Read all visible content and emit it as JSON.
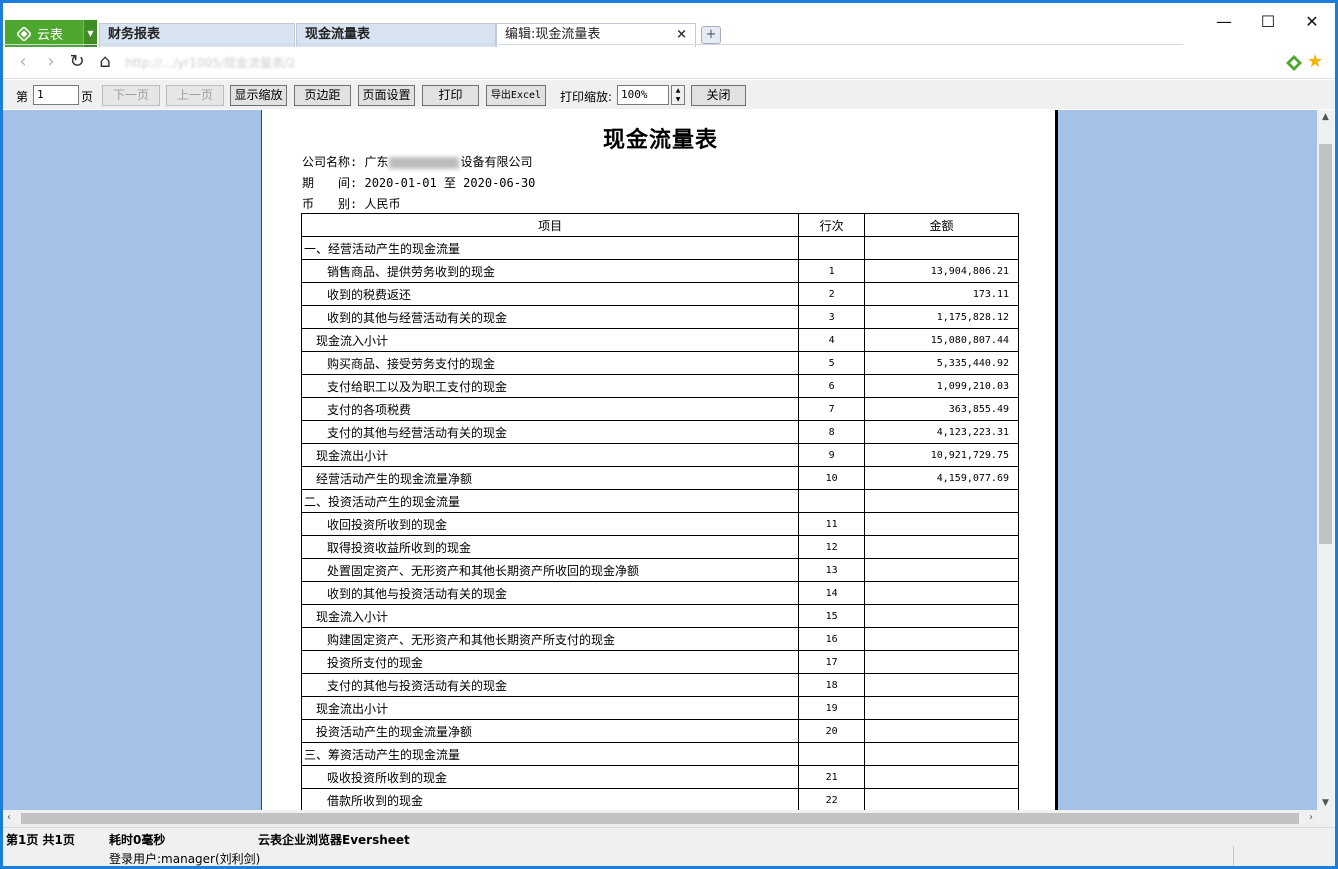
{
  "tabs": {
    "brand_label": "云表",
    "items": [
      {
        "label": "财务报表"
      },
      {
        "label": "现金流量表"
      },
      {
        "label": "编辑:现金流量表"
      }
    ],
    "close_glyph": "×",
    "new_tab_glyph": "+"
  },
  "window_controls": {
    "minimize": "—",
    "maximize": "☐",
    "close": "✕"
  },
  "addressbar": {
    "back": "‹",
    "forward": "›",
    "refresh": "↻",
    "home": "⌂",
    "url": "http://.../yr1005/现金流量表/2"
  },
  "toolbar": {
    "page_prefix": "第",
    "page_value": "1",
    "page_suffix": "页",
    "next_page": "下一页",
    "prev_page": "上一页",
    "show_zoom": "显示缩放",
    "margins": "页边距",
    "page_setup": "页面设置",
    "print": "打印",
    "export_excel": "导出Excel",
    "print_zoom_label": "打印缩放:",
    "print_zoom_value": "100%",
    "close": "关闭"
  },
  "report": {
    "title": "现金流量表",
    "company_label": "公司名称:",
    "company_prefix": "广东",
    "company_suffix": "设备有限公司",
    "period_label": "期　　间:",
    "period_value": "2020-01-01 至 2020-06-30",
    "currency_label": "币　　别:",
    "currency_value": "人民币",
    "columns": [
      "项目",
      "行次",
      "金额"
    ],
    "rows": [
      {
        "item": "一、经营活动产生的现金流量",
        "line": "",
        "amount": "",
        "level": 0
      },
      {
        "item": "销售商品、提供劳务收到的现金",
        "line": "1",
        "amount": "13,904,806.21",
        "level": 2
      },
      {
        "item": "收到的税费返还",
        "line": "2",
        "amount": "173.11",
        "level": 2
      },
      {
        "item": "收到的其他与经营活动有关的现金",
        "line": "3",
        "amount": "1,175,828.12",
        "level": 2
      },
      {
        "item": "现金流入小计",
        "line": "4",
        "amount": "15,080,807.44",
        "level": 1
      },
      {
        "item": "购买商品、接受劳务支付的现金",
        "line": "5",
        "amount": "5,335,440.92",
        "level": 2
      },
      {
        "item": "支付给职工以及为职工支付的现金",
        "line": "6",
        "amount": "1,099,210.03",
        "level": 2
      },
      {
        "item": "支付的各项税费",
        "line": "7",
        "amount": "363,855.49",
        "level": 2
      },
      {
        "item": "支付的其他与经营活动有关的现金",
        "line": "8",
        "amount": "4,123,223.31",
        "level": 2
      },
      {
        "item": "现金流出小计",
        "line": "9",
        "amount": "10,921,729.75",
        "level": 1
      },
      {
        "item": "经营活动产生的现金流量净额",
        "line": "10",
        "amount": "4,159,077.69",
        "level": 1
      },
      {
        "item": "二、投资活动产生的现金流量",
        "line": "",
        "amount": "",
        "level": 0
      },
      {
        "item": "收回投资所收到的现金",
        "line": "11",
        "amount": "",
        "level": 2
      },
      {
        "item": "取得投资收益所收到的现金",
        "line": "12",
        "amount": "",
        "level": 2
      },
      {
        "item": "处置固定资产、无形资产和其他长期资产所收回的现金净额",
        "line": "13",
        "amount": "",
        "level": 2
      },
      {
        "item": "收到的其他与投资活动有关的现金",
        "line": "14",
        "amount": "",
        "level": 2
      },
      {
        "item": "现金流入小计",
        "line": "15",
        "amount": "",
        "level": 1
      },
      {
        "item": "购建固定资产、无形资产和其他长期资产所支付的现金",
        "line": "16",
        "amount": "",
        "level": 2
      },
      {
        "item": "投资所支付的现金",
        "line": "17",
        "amount": "",
        "level": 2
      },
      {
        "item": "支付的其他与投资活动有关的现金",
        "line": "18",
        "amount": "",
        "level": 2
      },
      {
        "item": "现金流出小计",
        "line": "19",
        "amount": "",
        "level": 1
      },
      {
        "item": "投资活动产生的现金流量净额",
        "line": "20",
        "amount": "",
        "level": 1
      },
      {
        "item": "三、筹资活动产生的现金流量",
        "line": "",
        "amount": "",
        "level": 0
      },
      {
        "item": "吸收投资所收到的现金",
        "line": "21",
        "amount": "",
        "level": 2
      },
      {
        "item": "借款所收到的现金",
        "line": "22",
        "amount": "",
        "level": 2
      }
    ]
  },
  "status": {
    "page_info": "第1页 共1页",
    "elapsed": "耗时0毫秒",
    "browser_name": "云表企业浏览器Eversheet",
    "user": "登录用户:manager(刘利剑)"
  },
  "colors": {
    "brand_green": "#4ea72e",
    "window_border": "#1b7fd9",
    "canvas_background": "#a4c2e8",
    "star": "#f2b600"
  }
}
